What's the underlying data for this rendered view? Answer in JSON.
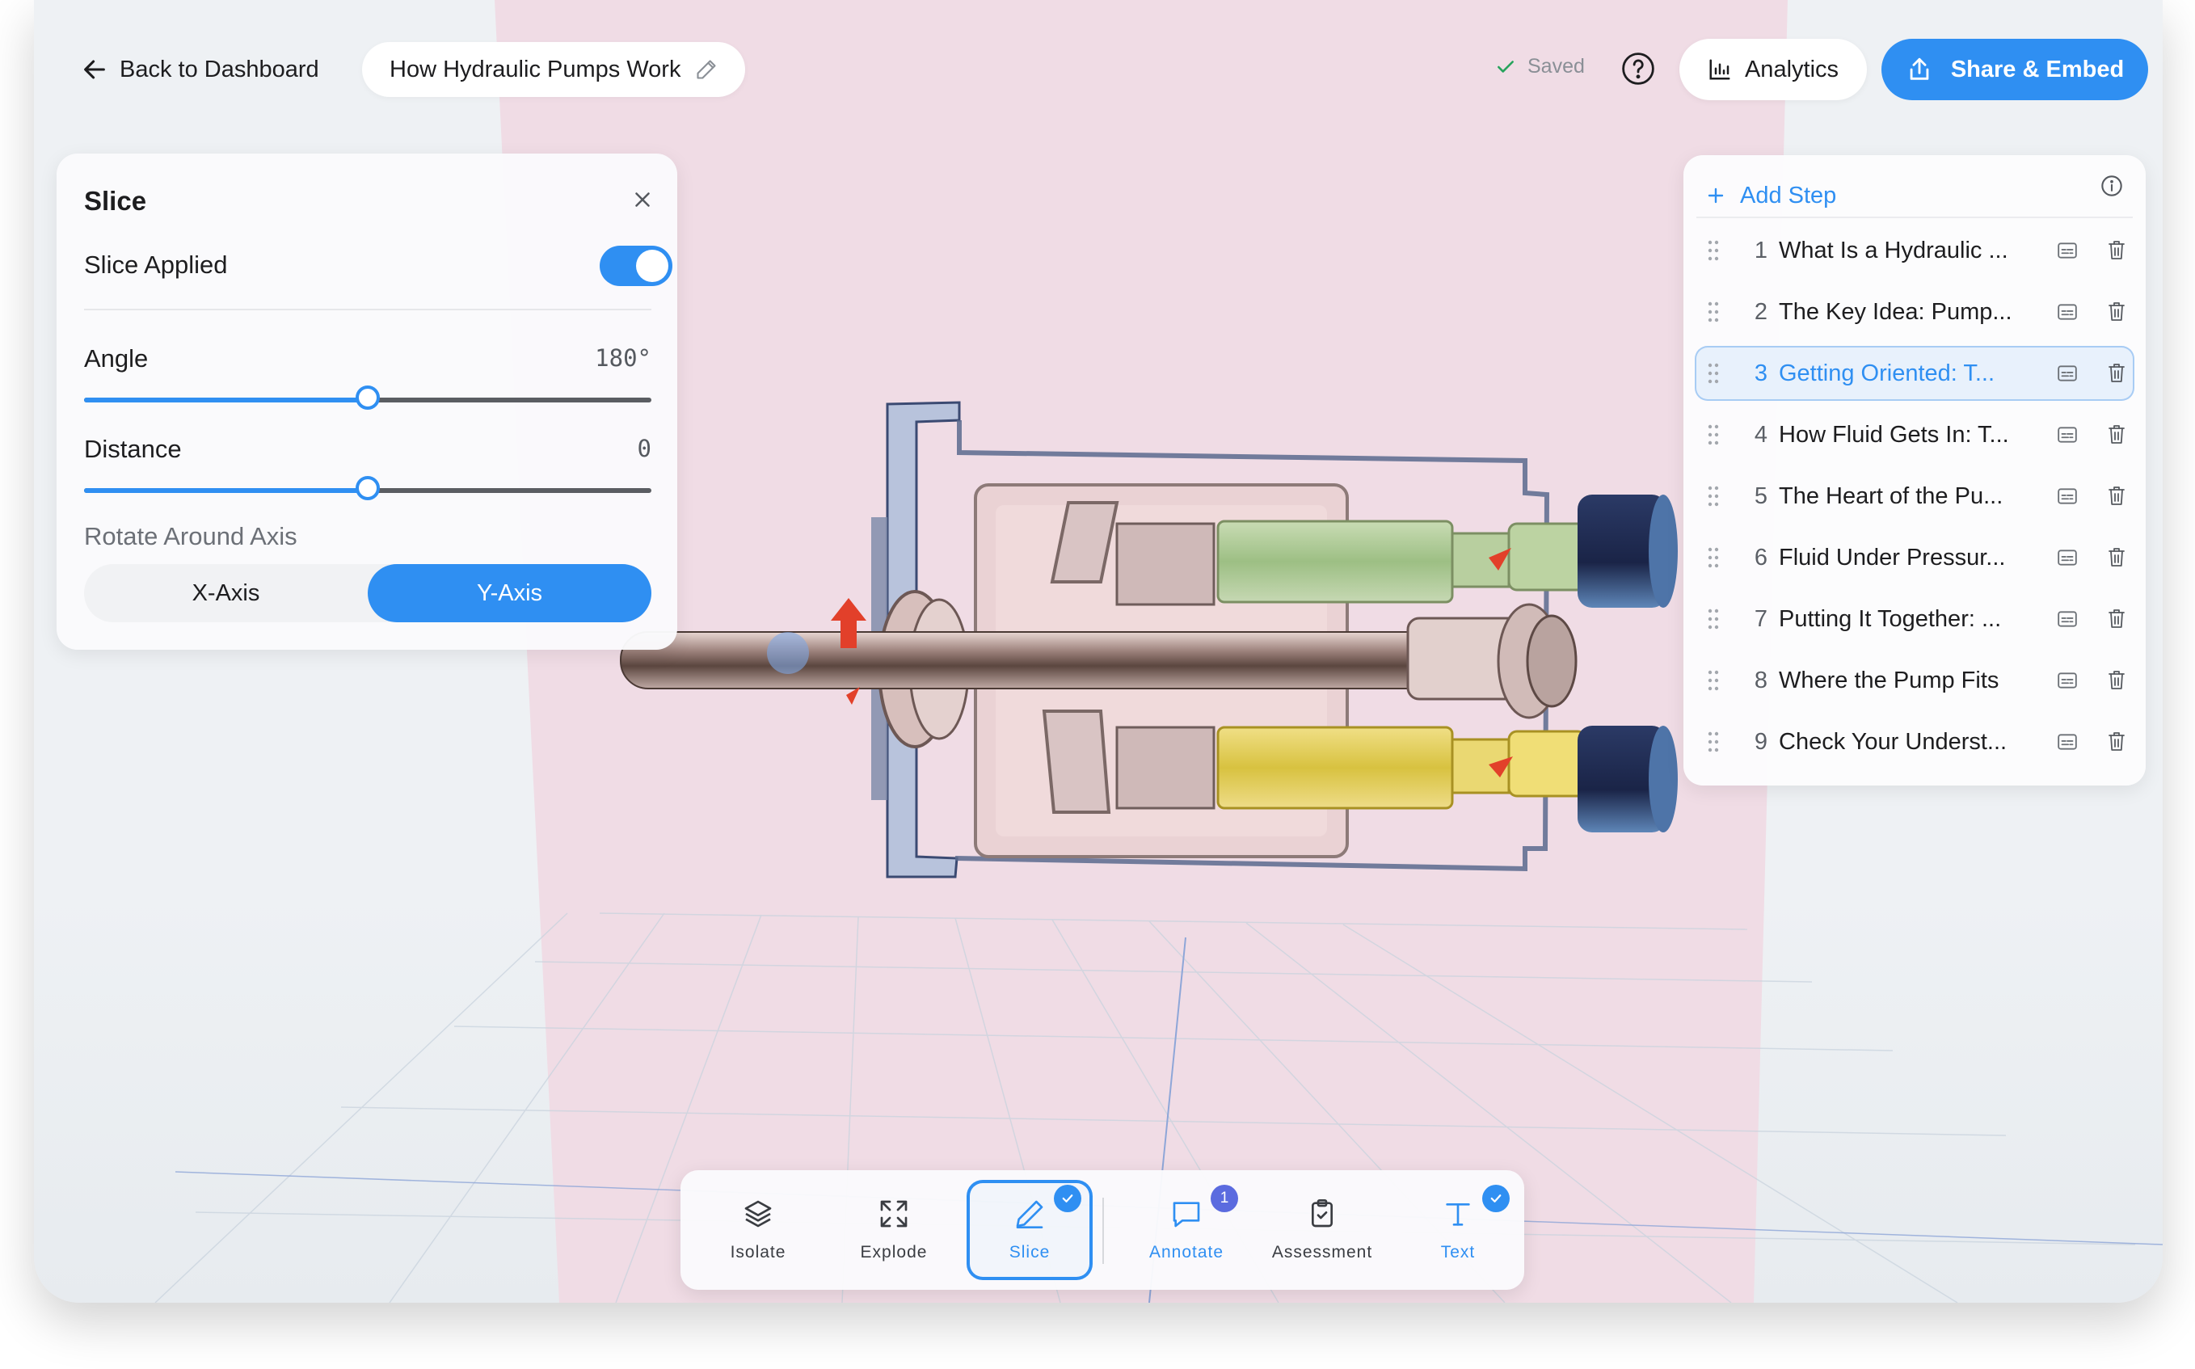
{
  "header": {
    "back_label": "Back to Dashboard",
    "title": "How Hydraulic Pumps Work",
    "saved_label": "Saved",
    "analytics_label": "Analytics",
    "share_label": "Share & Embed"
  },
  "slice_panel": {
    "title": "Slice",
    "slice_applied_label": "Slice Applied",
    "slice_applied": true,
    "angle_label": "Angle",
    "angle_value": "180°",
    "angle_fraction": 0.5,
    "distance_label": "Distance",
    "distance_value": "0",
    "distance_fraction": 0.5,
    "rotate_label": "Rotate Around Axis",
    "axis_options": [
      "X-Axis",
      "Y-Axis"
    ],
    "selected_axis": "Y-Axis"
  },
  "steps": {
    "add_label": "Add Step",
    "active_index": 3,
    "items": [
      {
        "num": "1",
        "label": "What Is a Hydraulic ..."
      },
      {
        "num": "2",
        "label": "The Key Idea: Pump..."
      },
      {
        "num": "3",
        "label": "Getting Oriented: T..."
      },
      {
        "num": "4",
        "label": "How Fluid Gets In: T..."
      },
      {
        "num": "5",
        "label": "The Heart of the Pu..."
      },
      {
        "num": "6",
        "label": "Fluid Under Pressur..."
      },
      {
        "num": "7",
        "label": "Putting It Together: ..."
      },
      {
        "num": "8",
        "label": "Where the Pump Fits"
      },
      {
        "num": "9",
        "label": "Check Your Underst..."
      }
    ]
  },
  "toolbar": {
    "isolate": "Isolate",
    "explode": "Explode",
    "slice": "Slice",
    "annotate": "Annotate",
    "annotate_count": "1",
    "assessment": "Assessment",
    "text": "Text"
  },
  "colors": {
    "accent": "#2f8ff2",
    "slice_plane": "#f0dce5",
    "background": "#eef1f4"
  }
}
